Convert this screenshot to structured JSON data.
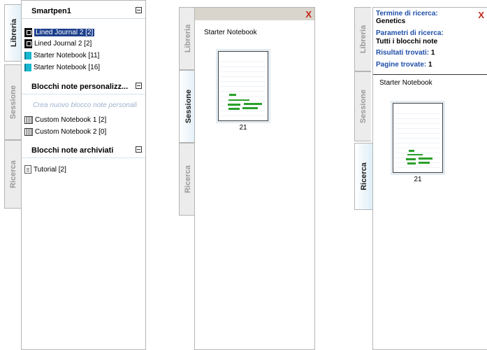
{
  "tabs": {
    "libreria": "Libreria",
    "sessione": "Sessione",
    "ricerca": "Ricerca"
  },
  "left_panel": {
    "smartpen_section": {
      "title": "Smartpen1",
      "items": [
        {
          "label": "Lined Journal 2 [2]",
          "icon": "journal-icon",
          "selected": true
        },
        {
          "label": "Lined Journal 2 [2]",
          "icon": "journal-icon",
          "selected": false
        },
        {
          "label": "Starter Notebook [11]",
          "icon": "notebook-icon",
          "selected": false
        },
        {
          "label": "Starter Notebook [16]",
          "icon": "notebook-icon",
          "selected": false
        }
      ]
    },
    "custom_section": {
      "title": "Blocchi note personalizz...",
      "placeholder": "Crea nuovo blocco note personali",
      "items": [
        {
          "label": "Custom Notebook 1 [2]",
          "icon": "custom-notebook-icon"
        },
        {
          "label": "Custom Notebook 2 [0]",
          "icon": "custom-notebook-icon"
        }
      ]
    },
    "archived_section": {
      "title": "Blocchi note archiviati",
      "items": [
        {
          "label": "Tutorial [2]",
          "icon": "document-icon"
        }
      ]
    }
  },
  "middle_panel": {
    "close_label": "X",
    "notebook_title": "Starter Notebook",
    "page_number": "21"
  },
  "right_panel": {
    "close_label": "X",
    "search_term_label": "Termine di ricerca:",
    "search_term_value": "Genetics",
    "params_label": "Parametri di ricerca:",
    "params_value": "Tutti i blocchi note",
    "results_label": "Risultati trovati:",
    "results_value": "1",
    "pages_label": "Pagine trovate:",
    "pages_value": "1",
    "notebook_title": "Starter Notebook",
    "page_number": "21"
  },
  "colors": {
    "selection": "#1c3f8c",
    "accent_blue": "#1f4fa8",
    "close_red": "#c0281a"
  }
}
